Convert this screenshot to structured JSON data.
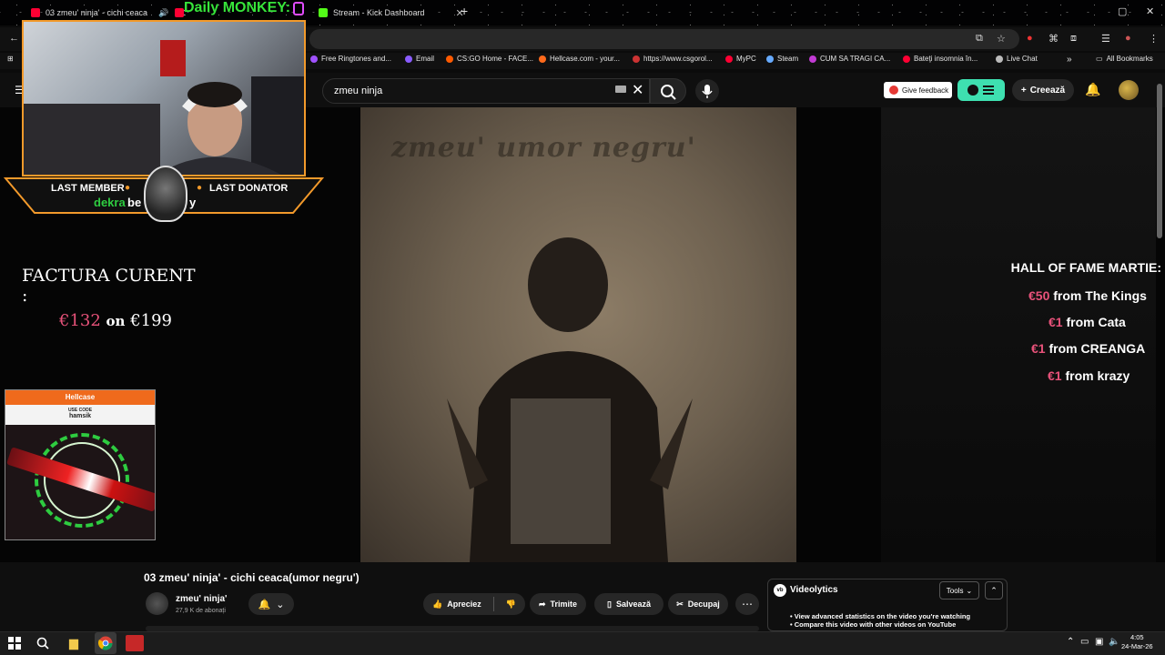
{
  "browser": {
    "tabs": [
      {
        "label": "03 zmeu' ninja' - cichi ceaca",
        "icon": "youtube-icon",
        "color": "#ff0033"
      },
      {
        "label": "",
        "icon": "youtube-icon",
        "color": "#ff0033"
      },
      {
        "label": "Stream - Kick Dashboard",
        "icon": "kick-icon",
        "color": "#53fc18"
      }
    ],
    "bookmarks": [
      {
        "label": "Free Ringtones and...",
        "color": "#a052ff"
      },
      {
        "label": "Email",
        "color": "#8a5cff"
      },
      {
        "label": "CS:GO Home - FACE...",
        "color": "#ff5a00"
      },
      {
        "label": "Hellcase.com - your...",
        "color": "#ff6a1c"
      },
      {
        "label": "https://www.csgorol...",
        "color": "#cc3333"
      },
      {
        "label": "MyPC",
        "color": "#ff0033"
      },
      {
        "label": "Steam",
        "color": "#66aaff"
      },
      {
        "label": "CUM SA TRAGI CA...",
        "color": "#c23bd4"
      },
      {
        "label": "Bateţi insomnia în...",
        "color": "#ff0033"
      },
      {
        "label": "Live Chat",
        "color": "#bbbbbb"
      }
    ],
    "all_bookmarks": "All Bookmarks"
  },
  "youtube": {
    "search_value": "zmeu ninja",
    "feedback": "Give feedback",
    "create": "Creează",
    "video_title": "03 zmeu' ninja' - cichi ceaca(umor negru')",
    "thumbnail_text": "zmeu' umor negru'",
    "channel_name": "zmeu' ninja'",
    "subscribers": "27,9 K de abonați",
    "actions": {
      "like": "Apreciez",
      "share": "Trimite",
      "save": "Salvează",
      "clip": "Decupaj"
    }
  },
  "videolytics": {
    "title": "Videolytics",
    "tools": "Tools",
    "items": [
      "View advanced statistics on the video you're watching",
      "Compare this video with other videos on YouTube"
    ]
  },
  "overlay": {
    "daily_title": "Daily MONKEY:",
    "last_member_label": "LAST MEMBER",
    "last_member_name": "dekra",
    "last_member_name_tail": "be",
    "last_donator_label": "LAST DONATOR",
    "last_donator_name": "y",
    "factura_title": "FACTURA CURENT :",
    "factura_current": "€132",
    "factura_on": "on",
    "factura_goal": "€199",
    "hellcase_brand": "Hellcase",
    "hellcase_code_label": "USE CODE",
    "hellcase_code": "hamsik",
    "hof_title": "HALL OF FAME MARTIE:",
    "hof": [
      {
        "amount": "€50",
        "text": "from The Kings"
      },
      {
        "amount": "€1",
        "text": "from Cata"
      },
      {
        "amount": "€1",
        "text": "from CREANGA"
      },
      {
        "amount": "€1",
        "text": "from krazy"
      }
    ]
  },
  "taskbar": {
    "time": "4:05",
    "date": "24-Mar-26"
  }
}
